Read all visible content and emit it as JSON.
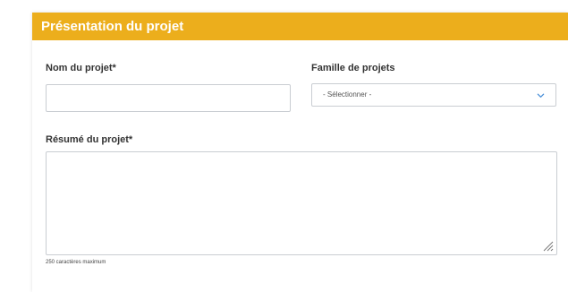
{
  "panel": {
    "title": "Présentation du projet",
    "header_color": "#ecae1c"
  },
  "form": {
    "project_name": {
      "label": "Nom du projet*",
      "value": ""
    },
    "project_family": {
      "label": "Famille de projets",
      "selected": "- Sélectionner -",
      "icon": "chevron-down-icon"
    },
    "summary": {
      "label": "Résumé du projet*",
      "value": "",
      "helper": "250 caractères maximum",
      "icon": "resize-handle-icon"
    }
  }
}
